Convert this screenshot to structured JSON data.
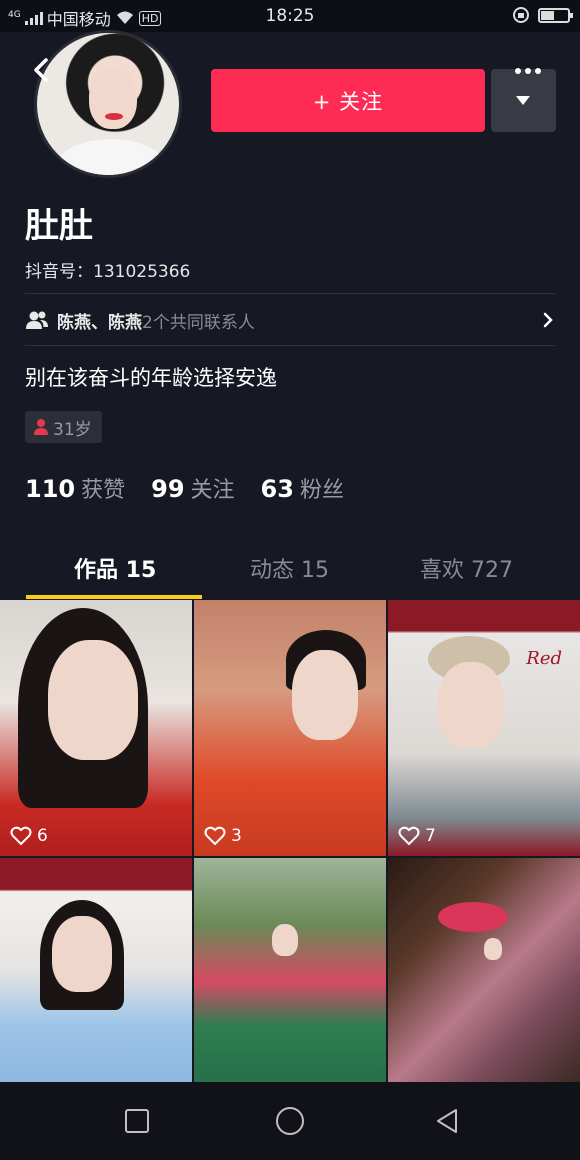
{
  "status_bar": {
    "carrier": "中国移动",
    "network": "4G",
    "volte": "HD",
    "time": "18:25",
    "battery_percent": 45
  },
  "profile": {
    "follow_label": "+ 关注",
    "nickname": "肚肚",
    "douyin_id_label": "抖音号：",
    "douyin_id": "131025366",
    "mutual_names": "陈燕、陈燕",
    "mutual_count_text": "2个共同联系人",
    "signature": "别在该奋斗的年龄选择安逸",
    "age": "31岁"
  },
  "stats": [
    {
      "num": "110",
      "label": "获赞"
    },
    {
      "num": "99",
      "label": "关注"
    },
    {
      "num": "63",
      "label": "粉丝"
    }
  ],
  "tabs": [
    {
      "label": "作品 15",
      "active": true
    },
    {
      "label": "动态 15",
      "active": false
    },
    {
      "label": "喜欢 727",
      "active": false
    }
  ],
  "videos": [
    {
      "likes": "6"
    },
    {
      "likes": "3"
    },
    {
      "likes": "7"
    },
    {
      "likes": ""
    },
    {
      "likes": ""
    },
    {
      "likes": ""
    }
  ],
  "thumb3_overlay_text": "Red",
  "colors": {
    "background": "#161823",
    "follow_button": "#fe2c55",
    "tab_underline": "#face15"
  },
  "icons": {
    "back": "back-arrow-icon",
    "more": "more-dots-icon",
    "dropdown": "dropdown-triangle-icon",
    "people": "people-icon",
    "chevron": "chevron-right-icon",
    "age_person": "person-icon",
    "heart": "heart-outline-icon"
  }
}
